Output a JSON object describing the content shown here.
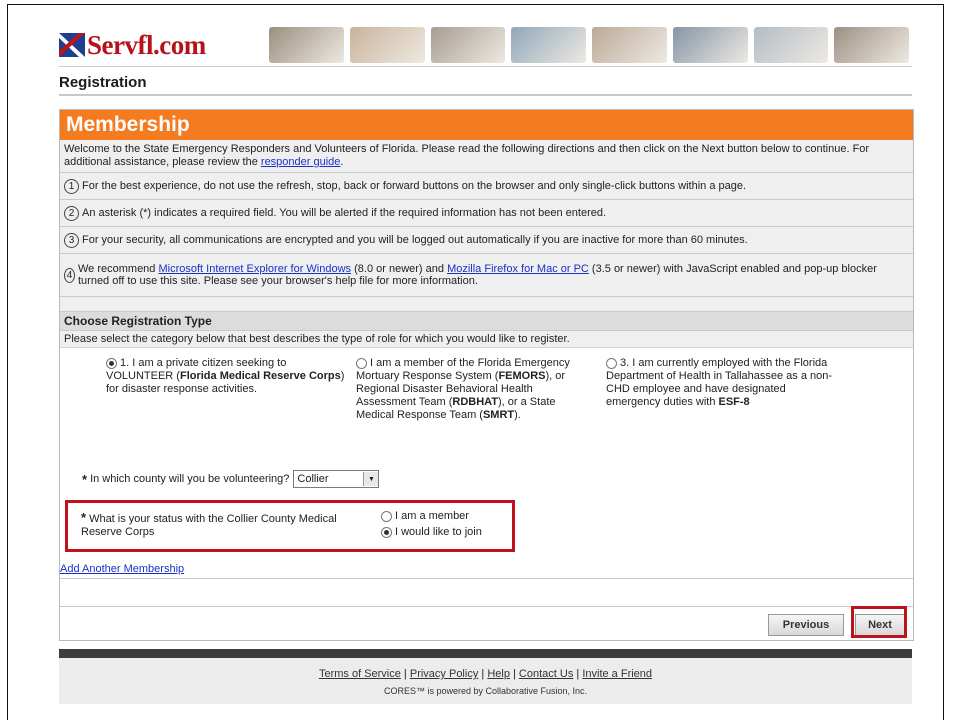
{
  "header": {
    "logo_text": "Servfl.com",
    "banner_colors": [
      "#7a6a55",
      "#b89a7a",
      "#8a7d6e",
      "#6d8aa3",
      "#a58e76",
      "#5e7389",
      "#9aa7b3",
      "#7d6c5c"
    ]
  },
  "page": {
    "title": "Registration"
  },
  "membership": {
    "heading": "Membership",
    "intro_text": "Welcome to the State Emergency Responders and Volunteers of Florida. Please read the following directions and then click on the Next button below to continue. For additional assistance, please review the ",
    "intro_link": "responder guide",
    "intro_end": ".",
    "steps": [
      {
        "num": "1",
        "text": "For the best experience, do not use the refresh, stop, back or forward buttons on the browser and only single-click buttons within a page."
      },
      {
        "num": "2",
        "text": "An asterisk (*) indicates a required field. You will be alerted if the required information has not been entered."
      },
      {
        "num": "3",
        "text": "For your security, all communications are encrypted and you will be logged out automatically if you are inactive for more than 60 minutes."
      }
    ],
    "step4": {
      "num": "4",
      "pre": "We recommend ",
      "link1": "Microsoft Internet Explorer for Windows",
      "mid1": " (8.0 or newer) and ",
      "link2": "Mozilla Firefox for Mac or PC",
      "post": " (3.5 or newer) with JavaScript enabled and pop-up blocker turned off to use this site. Please see your browser's help file for more information."
    }
  },
  "registration_type": {
    "heading": "Choose Registration Type",
    "instruction": "Please select the category below that best describes the type of role for which you would like to register.",
    "option1": {
      "a": "1. I am a private citizen seeking to VOLUNTEER (",
      "b": "Florida Medical Reserve Corps",
      "c": ") for disaster response activities.",
      "selected": true
    },
    "option2": {
      "a": "I am a member of the Florida Emergency Mortuary Response System (",
      "b": "FEMORS",
      "c": "), or Regional Disaster Behavioral Health Assessment Team (",
      "d": "RDBHAT",
      "e": "), or a State Medical Response Team (",
      "f": "SMRT",
      "g": ").",
      "selected": false
    },
    "option3": {
      "a": "3. I am currently employed with the Florida Department of Health in Tallahassee as a non-CHD employee and have designated emergency duties with ",
      "b": "ESF-8",
      "selected": false
    }
  },
  "county": {
    "asterisk": "*",
    "question": "In which county will you be volunteering?",
    "selected": "Collier"
  },
  "status": {
    "asterisk": "*",
    "question": "What is your status with the Collier County Medical Reserve Corps",
    "option_member": "I am a member",
    "option_join": "I would like to join",
    "selected": "join"
  },
  "add_membership_link": "Add Another Membership",
  "buttons": {
    "previous": "Previous",
    "next": "Next"
  },
  "footer": {
    "links": [
      "Terms of Service",
      "Privacy Policy",
      "Help",
      "Contact Us",
      "Invite a Friend"
    ],
    "separator": " | ",
    "powered_by": "CORES™ is powered by Collaborative Fusion, Inc."
  }
}
